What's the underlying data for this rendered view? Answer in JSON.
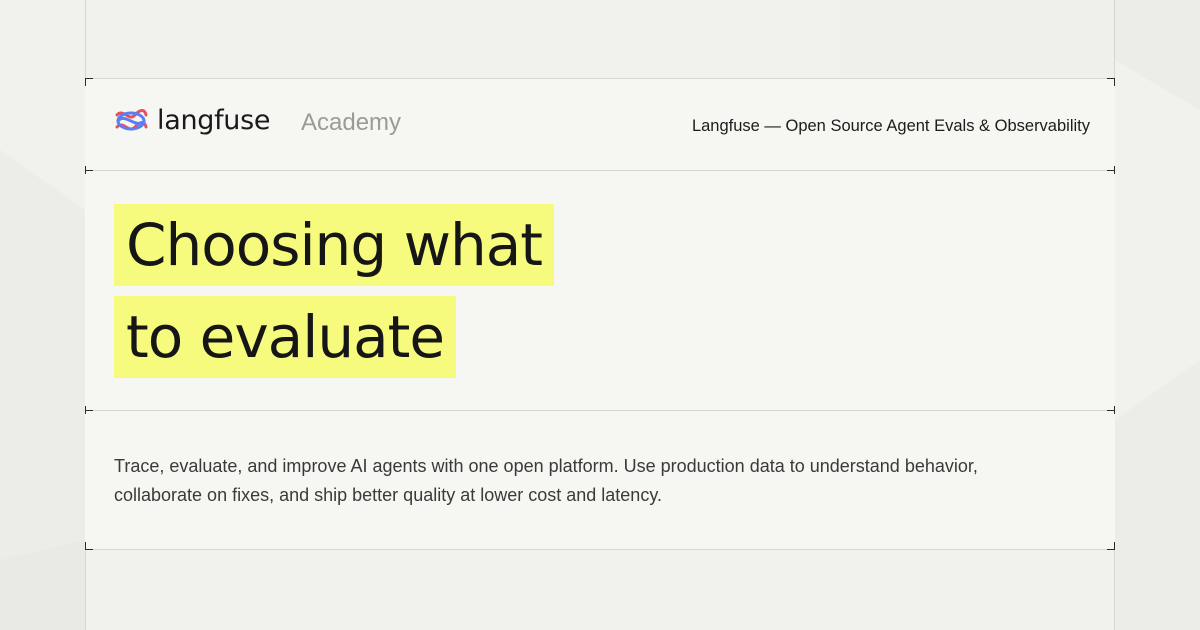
{
  "brand": {
    "logo_text": "langfuse",
    "section_label": "Academy",
    "tagline": "Langfuse — Open Source Agent Evals & Observability",
    "icon": "langfuse-knot-icon",
    "icon_colors": [
      "#e6505f",
      "#5b7ff0"
    ]
  },
  "headline": {
    "lines": [
      "Choosing what",
      "to evaluate"
    ],
    "highlight_color": "#f7fb7d"
  },
  "description": "Trace, evaluate, and improve AI agents with one open platform. Use production data to understand behavior, collaborate on fixes, and ship better quality at lower cost and latency."
}
